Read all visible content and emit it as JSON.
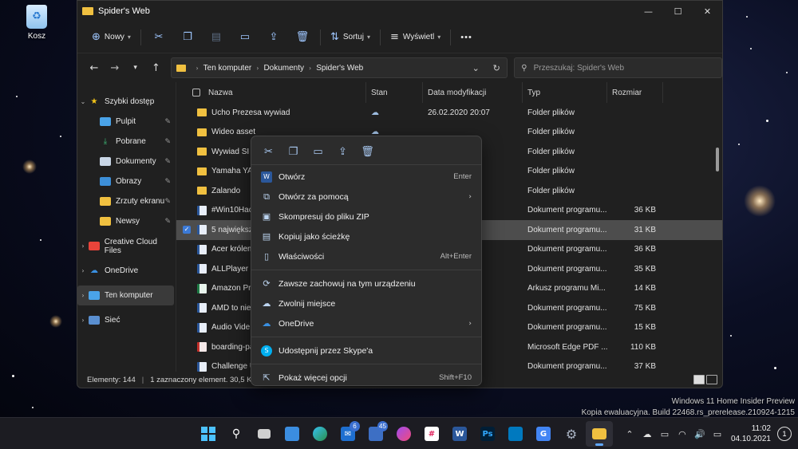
{
  "desktop": {
    "recycle_bin_label": "Kosz"
  },
  "window": {
    "title": "Spider's Web",
    "controls": {
      "minimize": "—",
      "maximize": "☐",
      "close": "✕"
    }
  },
  "toolbar": {
    "new_label": "Nowy",
    "sort_label": "Sortuj",
    "view_label": "Wyświetl",
    "more": "•••"
  },
  "address": {
    "crumbs": [
      "Ten komputer",
      "Dokumenty",
      "Spider's Web"
    ],
    "search_placeholder": "Przeszukaj: Spider's Web"
  },
  "nav_pane": {
    "items": [
      {
        "label": "Szybki dostęp",
        "icon": "star-icon"
      },
      {
        "label": "Pulpit",
        "icon": "desktop-icon"
      },
      {
        "label": "Pobrane",
        "icon": "download-icon"
      },
      {
        "label": "Dokumenty",
        "icon": "documents-icon"
      },
      {
        "label": "Obrazy",
        "icon": "pictures-icon"
      },
      {
        "label": "Zrzuty ekranu",
        "icon": "folder-icon"
      },
      {
        "label": "Newsy",
        "icon": "folder-icon"
      },
      {
        "label": "Creative Cloud Files",
        "icon": "creative-cloud-icon"
      },
      {
        "label": "OneDrive",
        "icon": "onedrive-icon"
      },
      {
        "label": "Ten komputer",
        "icon": "computer-icon"
      },
      {
        "label": "Sieć",
        "icon": "network-icon"
      }
    ]
  },
  "columns": {
    "name": "Nazwa",
    "state": "Stan",
    "date": "Data modyfikacji",
    "type": "Typ",
    "size": "Rozmiar"
  },
  "files": [
    {
      "name": "Ucho Prezesa wywiad",
      "date": "26.02.2020 20:07",
      "type": "Folder plików",
      "size": ""
    },
    {
      "name": "Wideo asset",
      "date": "",
      "type": "Folder plików",
      "size": ""
    },
    {
      "name": "Wywiad SI",
      "date": "7",
      "type": "Folder plików",
      "size": ""
    },
    {
      "name": "Yamaha YAS",
      "date": "8",
      "type": "Folder plików",
      "size": ""
    },
    {
      "name": "Zalando",
      "date": "0",
      "type": "Folder plików",
      "size": ""
    },
    {
      "name": "#Win10Hack",
      "date": "3",
      "type": "Dokument programu...",
      "size": "36 KB"
    },
    {
      "name": "5 największy",
      "date": "8",
      "type": "Dokument programu...",
      "size": "31 KB"
    },
    {
      "name": "Acer królem",
      "date": "1",
      "type": "Dokument programu...",
      "size": "36 KB"
    },
    {
      "name": "ALLPlayer -",
      "date": "4",
      "type": "Dokument programu...",
      "size": "35 KB"
    },
    {
      "name": "Amazon Prin",
      "date": "7",
      "type": "Arkusz programu Mi...",
      "size": "14 KB"
    },
    {
      "name": "AMD to nie",
      "date": "8",
      "type": "Dokument programu...",
      "size": "75 KB"
    },
    {
      "name": "Audio Vide",
      "date": "4",
      "type": "Dokument programu...",
      "size": "15 KB"
    },
    {
      "name": "boarding-pa",
      "date": "3",
      "type": "Microsoft Edge PDF ...",
      "size": "110 KB"
    },
    {
      "name": "Challenge U",
      "date": "",
      "type": "Dokument programu...",
      "size": "37 KB"
    }
  ],
  "status": {
    "count": "Elementy: 144",
    "selected": "1 zaznaczony element. 30,5 KB"
  },
  "context_menu": {
    "items": [
      {
        "label": "Otwórz",
        "accel": "Enter"
      },
      {
        "label": "Otwórz za pomocą",
        "accel": ""
      },
      {
        "label": "Skompresuj do pliku ZIP",
        "accel": ""
      },
      {
        "label": "Kopiuj jako ścieżkę",
        "accel": ""
      },
      {
        "label": "Właściwości",
        "accel": "Alt+Enter"
      },
      {
        "label": "Zawsze zachowuj na tym urządzeniu",
        "accel": ""
      },
      {
        "label": "Zwolnij miejsce",
        "accel": ""
      },
      {
        "label": "OneDrive",
        "accel": ""
      },
      {
        "label": "Udostępnij przez Skype'a",
        "accel": ""
      },
      {
        "label": "Pokaż więcej opcji",
        "accel": "Shift+F10"
      }
    ]
  },
  "watermark": {
    "line1": "Windows 11 Home Insider Preview",
    "line2": "Kopia ewaluacyjna. Build 22468.rs_prerelease.210924-1215"
  },
  "taskbar": {
    "badges": {
      "mail": "6",
      "teams": "45"
    },
    "time": "11:02",
    "date": "04.10.2021",
    "notifications": "1"
  },
  "colors": {
    "accent": "#60a8ff",
    "window_bg": "#202020",
    "menu_bg": "#2c2c2c",
    "selection": "#4d4d4d"
  }
}
